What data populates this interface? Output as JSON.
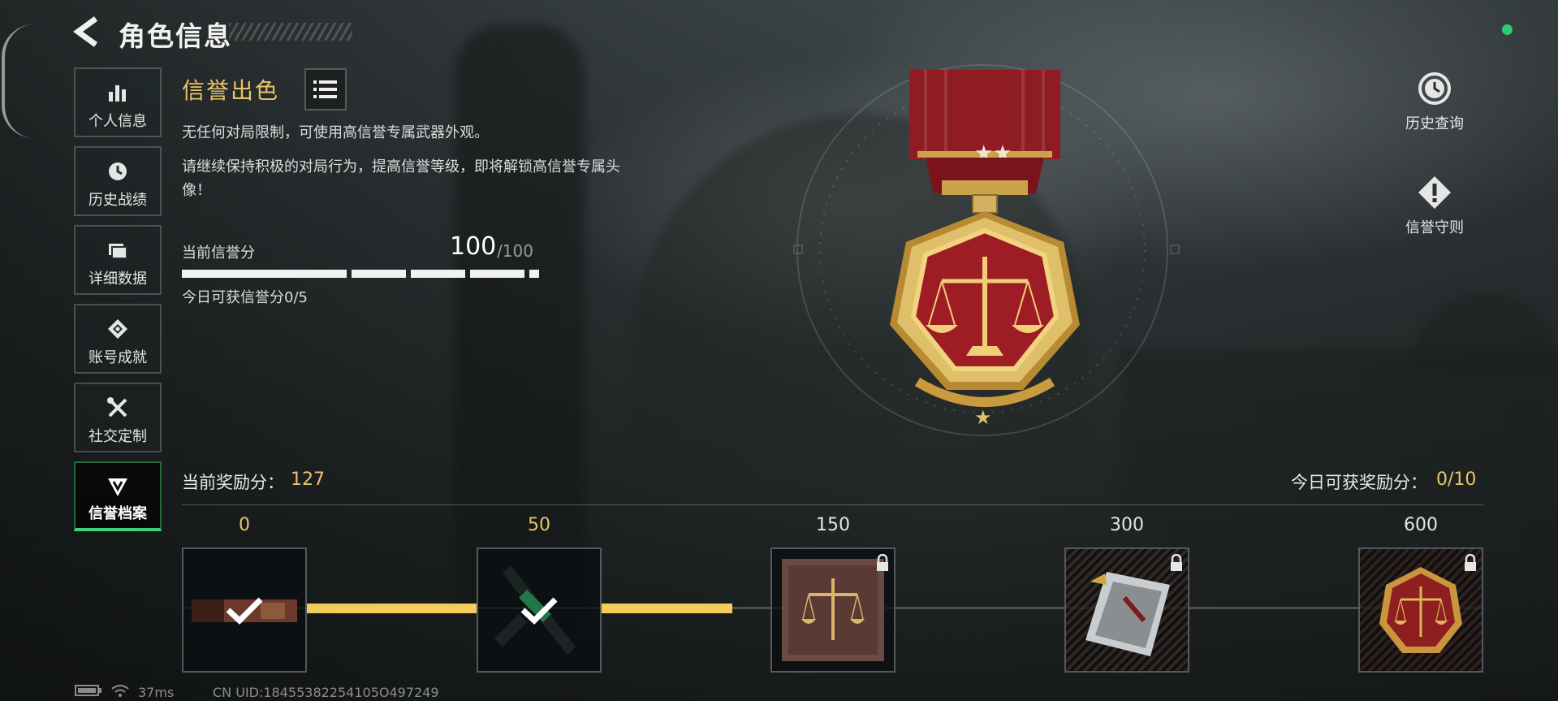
{
  "header": {
    "title": "角色信息"
  },
  "sidebar": {
    "items": [
      {
        "label": "个人信息",
        "icon": "bar-chart-icon",
        "active": false
      },
      {
        "label": "历史战绩",
        "icon": "clock-icon",
        "active": false
      },
      {
        "label": "详细数据",
        "icon": "folder-icon",
        "active": false
      },
      {
        "label": "账号成就",
        "icon": "achievement-icon",
        "active": false
      },
      {
        "label": "社交定制",
        "icon": "tools-icon",
        "active": false
      },
      {
        "label": "信誉档案",
        "icon": "credit-shield-icon",
        "active": true
      }
    ]
  },
  "credit": {
    "title": "信誉出色",
    "desc1": "无任何对局限制，可使用高信誉专属武器外观。",
    "desc2": "请继续保持积极的对局行为，提高信誉等级，即将解锁高信誉专属头像！",
    "score_label": "当前信誉分",
    "score": "100",
    "score_max": "/100",
    "score_fraction": 1.0,
    "daily_label": "今日可获信誉分0/5"
  },
  "right_actions": {
    "history": "历史查询",
    "rules": "信誉守则"
  },
  "rewards": {
    "current_label": "当前奖励分：",
    "current_value": "127",
    "daily_label": "今日可获奖励分：",
    "daily_value": "0/10",
    "tiers": [
      {
        "threshold": "0",
        "status": "claimed",
        "item": "weapon-camo"
      },
      {
        "threshold": "50",
        "status": "claimed",
        "item": "weapon-skin"
      },
      {
        "threshold": "150",
        "status": "locked",
        "item": "credit-emblem"
      },
      {
        "threshold": "300",
        "status": "locked",
        "item": "calling-card"
      },
      {
        "threshold": "600",
        "status": "locked",
        "item": "credit-badge"
      }
    ]
  },
  "status_bar": {
    "ping": "37ms",
    "uid": "CN UID:18455382254105O497249"
  },
  "colors": {
    "accent_gold": "#e9c46a",
    "active_green": "#3fd07a",
    "status_dot": "#2ecc71"
  }
}
